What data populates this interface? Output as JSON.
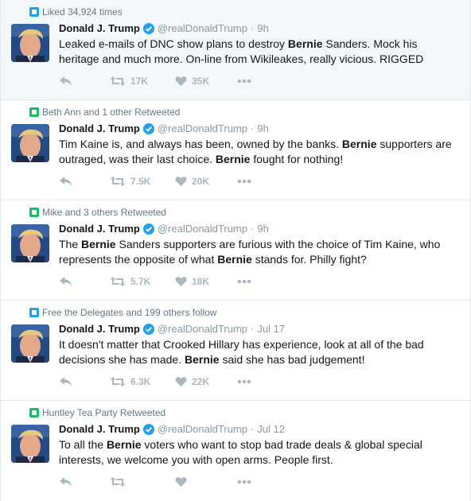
{
  "tweets": [
    {
      "context_icon": "heart-badge-icon",
      "context_color": "#1da1f2",
      "context": "Liked 34,924 times",
      "name": "Donald J. Trump",
      "handle": "@realDonaldTrump",
      "time": "9h",
      "text_parts": [
        {
          "t": "Leaked e-mails of DNC show plans to destroy ",
          "b": false
        },
        {
          "t": "Bernie",
          "b": true
        },
        {
          "t": " Sanders. Mock his heritage and much more. On-line from Wikileakes, really vicious. RIGGED",
          "b": false
        }
      ],
      "retweets": "17K",
      "likes": "35K",
      "highlight": true
    },
    {
      "context_icon": "retweet-badge-icon",
      "context_color": "#17bf63",
      "context": "Beth Ann and 1 other Retweeted",
      "name": "Donald J. Trump",
      "handle": "@realDonaldTrump",
      "time": "9h",
      "text_parts": [
        {
          "t": "Tim Kaine is, and always has been, owned by the banks. ",
          "b": false
        },
        {
          "t": "Bernie",
          "b": true
        },
        {
          "t": " supporters are outraged, was their last choice. ",
          "b": false
        },
        {
          "t": "Bernie",
          "b": true
        },
        {
          "t": " fought for nothing!",
          "b": false
        }
      ],
      "retweets": "7.5K",
      "likes": "20K",
      "highlight": false
    },
    {
      "context_icon": "retweet-badge-icon",
      "context_color": "#17bf63",
      "context": "Mike and 3 others Retweeted",
      "name": "Donald J. Trump",
      "handle": "@realDonaldTrump",
      "time": "9h",
      "text_parts": [
        {
          "t": "The ",
          "b": false
        },
        {
          "t": "Bernie",
          "b": true
        },
        {
          "t": " Sanders supporters are furious with the choice of Tim Kaine, who represents the opposite of what ",
          "b": false
        },
        {
          "t": "Bernie",
          "b": true
        },
        {
          "t": " stands for. Philly fight?",
          "b": false
        }
      ],
      "retweets": "5.7K",
      "likes": "18K",
      "highlight": false
    },
    {
      "context_icon": "follow-badge-icon",
      "context_color": "#1da1f2",
      "context": "Free the Delegates and 199 others follow",
      "name": "Donald J. Trump",
      "handle": "@realDonaldTrump",
      "time": "Jul 17",
      "text_parts": [
        {
          "t": "It doesn't matter that Crooked Hillary has experience, look at all of the bad decisions she has made. ",
          "b": false
        },
        {
          "t": "Bernie",
          "b": true
        },
        {
          "t": " said she has bad judgement!",
          "b": false
        }
      ],
      "retweets": "6.3K",
      "likes": "22K",
      "highlight": false
    },
    {
      "context_icon": "retweet-badge-icon",
      "context_color": "#17bf63",
      "context": "Huntley Tea Party Retweeted",
      "name": "Donald J. Trump",
      "handle": "@realDonaldTrump",
      "time": "Jul 12",
      "text_parts": [
        {
          "t": "To all the ",
          "b": false
        },
        {
          "t": "Bernie",
          "b": true
        },
        {
          "t": " voters who want to stop bad trade deals & global special interests, we welcome you with open arms. People first.",
          "b": false
        }
      ],
      "retweets": "",
      "likes": "",
      "highlight": false
    }
  ]
}
